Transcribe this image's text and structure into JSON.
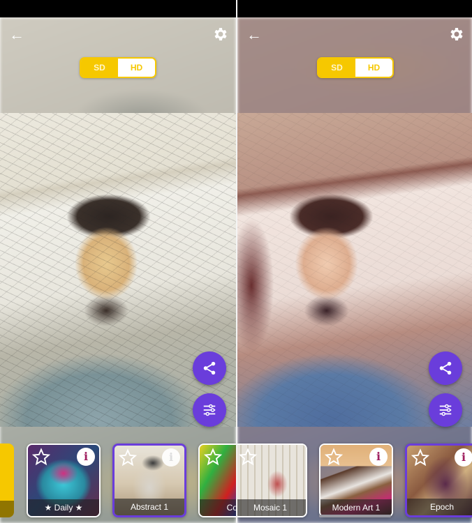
{
  "left_screen": {
    "top_bar": {
      "back_icon": "←",
      "settings_icon": "gear-icon"
    },
    "quality_toggle": {
      "options": [
        "SD",
        "HD"
      ],
      "selected": "SD"
    },
    "fabs": {
      "share_icon": "share-icon",
      "adjust_icon": "sliders-icon"
    },
    "filters": [
      {
        "label": "",
        "partial": true,
        "color": "#f6c800"
      },
      {
        "label": "★ Daily ★",
        "has_info": true,
        "selected": false
      },
      {
        "label": "Abstract 1",
        "has_info": true,
        "selected": true
      },
      {
        "label": "Colo",
        "has_info": false,
        "selected": false
      }
    ]
  },
  "right_screen": {
    "top_bar": {
      "back_icon": "←",
      "settings_icon": "gear-icon"
    },
    "quality_toggle": {
      "options": [
        "SD",
        "HD"
      ],
      "selected": "SD"
    },
    "fabs": {
      "share_icon": "share-icon",
      "adjust_icon": "sliders-icon"
    },
    "filters": [
      {
        "label": "Mosaic 1",
        "has_info": false,
        "selected": false
      },
      {
        "label": "Modern Art 1",
        "has_info": true,
        "selected": false
      },
      {
        "label": "Epoch",
        "has_info": true,
        "selected": true
      }
    ]
  },
  "colors": {
    "accent_yellow": "#f6c800",
    "accent_purple": "#6a3ddb"
  },
  "info_glyph": "i"
}
